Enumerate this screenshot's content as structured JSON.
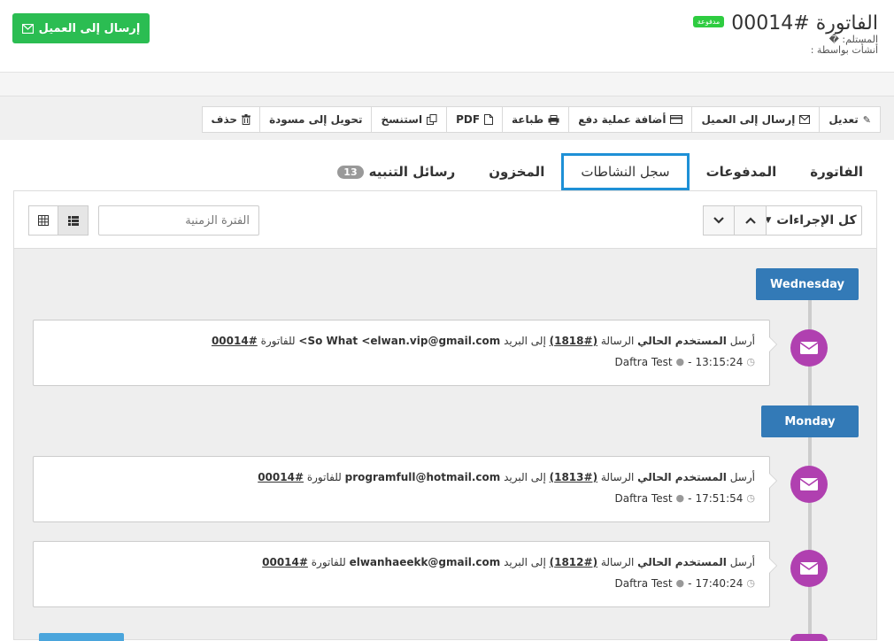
{
  "header": {
    "invoice_title": "الفاتورة #00014",
    "paid_badge": "مدفوعة",
    "recipient_line": "المستلم: �",
    "created_by_line": "أنشأت بواسطة :",
    "send_button": "إرسال إلى العميل"
  },
  "toolbar": {
    "items": [
      {
        "label": "تعديل",
        "icon": "pencil-icon"
      },
      {
        "label": "إرسال إلى العميل",
        "icon": "envelope-icon"
      },
      {
        "label": "أضافة عملية دفع",
        "icon": "credit-card-icon"
      },
      {
        "label": "طباعة",
        "icon": "print-icon"
      },
      {
        "label": "PDF",
        "icon": "pdf-file-icon"
      },
      {
        "label": "استنسخ",
        "icon": "copy-icon"
      },
      {
        "label": "تحويل إلى مسودة",
        "icon": ""
      },
      {
        "label": "حذف",
        "icon": "trash-icon"
      }
    ]
  },
  "tabs": {
    "items": [
      {
        "label": "الفاتورة"
      },
      {
        "label": "المدفوعات"
      },
      {
        "label": "سجل النشاطات"
      },
      {
        "label": "المخزون"
      },
      {
        "label": "رسائل التنبيه",
        "count": "13"
      }
    ]
  },
  "filters": {
    "actions_select": "كل الإجراءات",
    "date_placeholder": "الفترة الزمنية"
  },
  "timeline": {
    "days": [
      "Wednesday",
      "Monday"
    ],
    "entries": [
      {
        "prefix": "أرسل",
        "user": "المستخدم الحالي",
        "msg_word": "الرسالة",
        "msg_id": "(#1818)",
        "to_word": "إلى البريد",
        "email": "So What <elwan.vip@gmail.com>",
        "for_word": "للفاتورة",
        "invoice": "#00014",
        "time": "13:15:24",
        "author": "Daftra Test"
      },
      {
        "prefix": "أرسل",
        "user": "المستخدم الحالي",
        "msg_word": "الرسالة",
        "msg_id": "(#1813)",
        "to_word": "إلى البريد",
        "email": "programfull@hotmail.com",
        "for_word": "للفاتورة",
        "invoice": "#00014",
        "time": "17:51:54",
        "author": "Daftra Test"
      },
      {
        "prefix": "أرسل",
        "user": "المستخدم الحالي",
        "msg_word": "الرسالة",
        "msg_id": "(#1812)",
        "to_word": "إلى البريد",
        "email": "elwanhaeekk@gmail.com",
        "for_word": "للفاتورة",
        "invoice": "#00014",
        "time": "17:40:24",
        "author": "Daftra Test"
      }
    ]
  },
  "colors": {
    "send_green": "#2bbd52",
    "tab_active_border": "#1e90d6",
    "day_label_blue": "#337ab7",
    "timeline_icon_purple": "#b040b0"
  }
}
